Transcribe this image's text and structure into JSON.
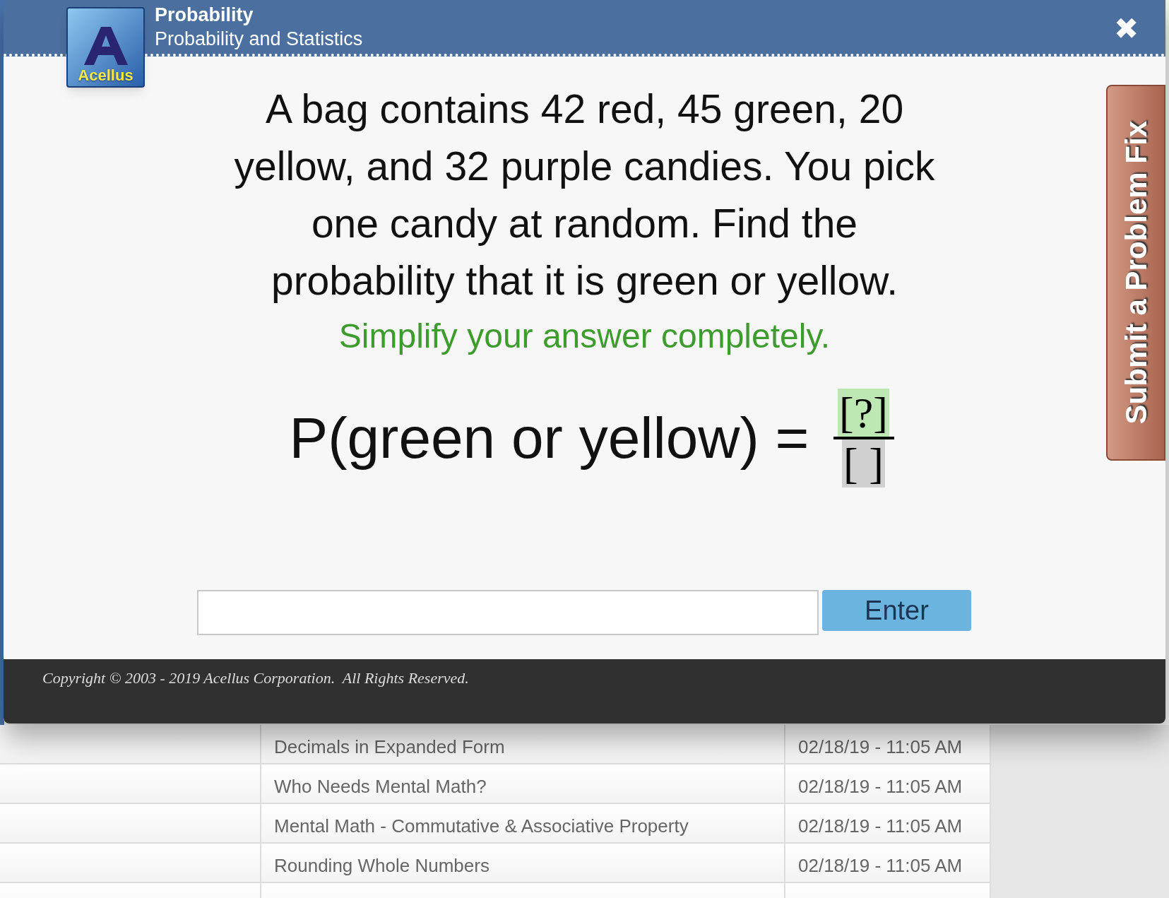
{
  "header": {
    "logo_text": "Acellus",
    "title": "Probability",
    "subtitle": "Probability and Statistics",
    "close": "✖"
  },
  "question": {
    "text": "A bag contains 42 red, 45 green, 20 yellow, and 32 purple candies. You pick one candy at random. Find the probability that it is green or yellow.",
    "instruction": "Simplify your answer completely.",
    "equation": "P(green or yellow) =",
    "numerator": "[?]",
    "denominator": "[ ]"
  },
  "answer": {
    "button": "Enter"
  },
  "side_tab": "Submit a Problem Fix",
  "footer": "Copyright © 2003 - 2019 Acellus Corporation.  All Rights Reserved.",
  "table": {
    "rows": [
      {
        "lesson": "Decimals in Expanded Form",
        "date": "02/18/19 - 11:05 AM"
      },
      {
        "lesson": "Who Needs Mental Math?",
        "date": "02/18/19 - 11:05 AM"
      },
      {
        "lesson": "Mental Math - Commutative & Associative Property",
        "date": "02/18/19 - 11:05 AM"
      },
      {
        "lesson": "Rounding Whole Numbers",
        "date": "02/18/19 - 11:05 AM"
      }
    ]
  }
}
